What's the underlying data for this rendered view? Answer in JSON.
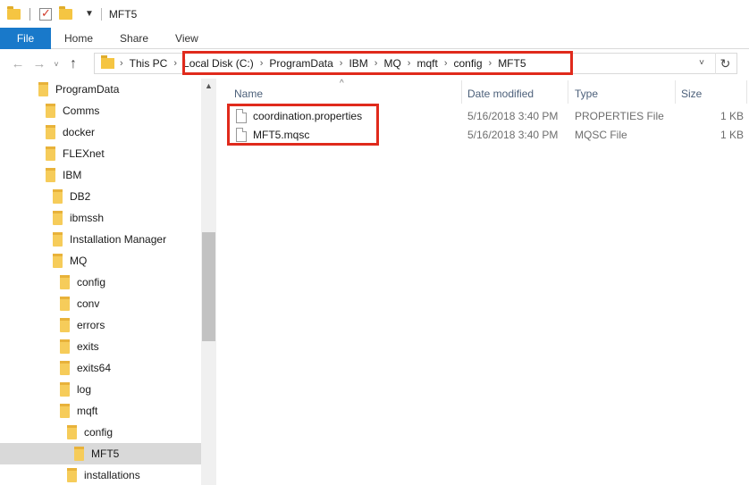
{
  "window": {
    "title": "MFT5"
  },
  "ribbon": {
    "tabs": [
      "File",
      "Home",
      "Share",
      "View"
    ]
  },
  "address": {
    "root": "This PC",
    "crumbs": [
      "Local Disk (C:)",
      "ProgramData",
      "IBM",
      "MQ",
      "mqft",
      "config",
      "MFT5"
    ]
  },
  "nav": {
    "items": [
      {
        "label": "ProgramData",
        "indent": 0
      },
      {
        "label": "Comms",
        "indent": 1
      },
      {
        "label": "docker",
        "indent": 1
      },
      {
        "label": "FLEXnet",
        "indent": 1
      },
      {
        "label": "IBM",
        "indent": 1
      },
      {
        "label": "DB2",
        "indent": 2
      },
      {
        "label": "ibmssh",
        "indent": 2
      },
      {
        "label": "Installation Manager",
        "indent": 2
      },
      {
        "label": "MQ",
        "indent": 2
      },
      {
        "label": "config",
        "indent": 3
      },
      {
        "label": "conv",
        "indent": 3
      },
      {
        "label": "errors",
        "indent": 3
      },
      {
        "label": "exits",
        "indent": 3
      },
      {
        "label": "exits64",
        "indent": 3
      },
      {
        "label": "log",
        "indent": 3
      },
      {
        "label": "mqft",
        "indent": 3
      },
      {
        "label": "config",
        "indent": 4
      },
      {
        "label": "MFT5",
        "indent": 5,
        "selected": true
      },
      {
        "label": "installations",
        "indent": 4
      }
    ]
  },
  "columns": {
    "name": "Name",
    "date": "Date modified",
    "type": "Type",
    "size": "Size"
  },
  "files": [
    {
      "name": "coordination.properties",
      "date": "5/16/2018 3:40 PM",
      "type": "PROPERTIES File",
      "size": "1 KB"
    },
    {
      "name": "MFT5.mqsc",
      "date": "5/16/2018 3:40 PM",
      "type": "MQSC File",
      "size": "1 KB"
    }
  ],
  "colors": {
    "file_tab": "#1979ca",
    "highlight": "#e02a1c",
    "folder": "#f6cc5a"
  }
}
